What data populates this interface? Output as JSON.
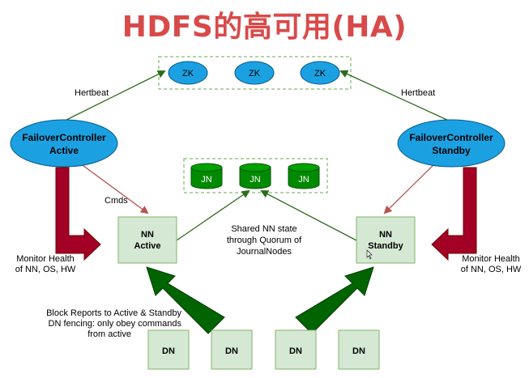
{
  "title": "HDFS的高可用(HA)",
  "zookeeper": {
    "nodes": [
      "ZK",
      "ZK",
      "ZK"
    ]
  },
  "journal": {
    "nodes": [
      "JN",
      "JN",
      "JN"
    ]
  },
  "failover_active": {
    "line1": "FailoverController",
    "line2": "Active"
  },
  "failover_standby": {
    "line1": "FailoverController",
    "line2": "Standby"
  },
  "nn_active": {
    "line1": "NN",
    "line2": "Active"
  },
  "nn_standby": {
    "line1": "NN",
    "line2": "Standby"
  },
  "datanodes": [
    "DN",
    "DN",
    "DN",
    "DN"
  ],
  "labels": {
    "heartbeat_left": "Hertbeat",
    "heartbeat_right": "Hertbeat",
    "cmds": "Cmds",
    "shared_state": [
      "Shared NN state",
      "through Quorum of",
      "JournalNodes"
    ],
    "monitor_left": [
      "Monitor Health",
      "of NN, OS, HW"
    ],
    "monitor_right": [
      "Monitor Health",
      "of NN, OS, HW"
    ],
    "block_reports": [
      "Block Reports to Active  & Standby",
      "DN fencing: only obey commands",
      "from active"
    ]
  },
  "colors": {
    "title": "#d84a4a",
    "zk_fill": "#1ba1e2",
    "fc_fill": "#1ba1e2",
    "jn_fill": "#008a00",
    "nn_fill": "#d5e8d4",
    "nn_stroke": "#82b366",
    "dark_red": "#a20025",
    "green_arrow": "#006400",
    "brown_line": "#b85450",
    "dark_green_line": "#2d6a1f"
  }
}
